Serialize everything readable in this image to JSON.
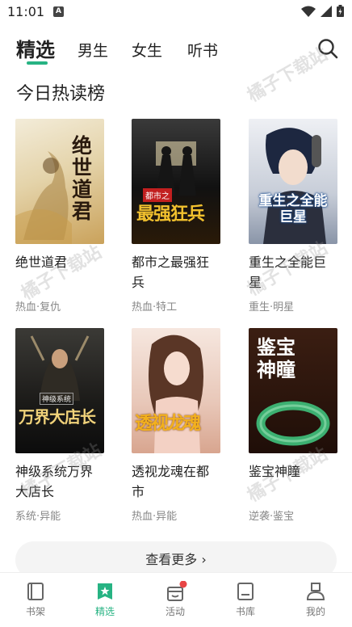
{
  "status": {
    "time": "11:01",
    "notif": "A"
  },
  "tabs": {
    "featured": "精选",
    "male": "男生",
    "female": "女生",
    "audio": "听书"
  },
  "section_title": "今日热读榜",
  "books": [
    {
      "title": "绝世道君",
      "tags": "热血·复仇",
      "cover_text": "绝世道君"
    },
    {
      "title": "都市之最强狂兵",
      "tags": "热血·特工",
      "cover_text": "最强狂兵"
    },
    {
      "title": "重生之全能巨星",
      "tags": "重生·明星",
      "cover_text": "重生之全能巨星"
    },
    {
      "title": "神级系统万界大店长",
      "tags": "系统·异能",
      "cover_text": "万界大店长"
    },
    {
      "title": "透视龙魂在都市",
      "tags": "热血·异能",
      "cover_text": "透视龙魂"
    },
    {
      "title": "鉴宝神瞳",
      "tags": "逆袭·鉴宝",
      "cover_text": "鉴宝神瞳"
    }
  ],
  "more_label": "查看更多",
  "watermark": "橘子下载站",
  "nav": {
    "shelf": "书架",
    "featured": "精选",
    "events": "活动",
    "library": "书库",
    "mine": "我的"
  },
  "colors": {
    "accent": "#27b383",
    "badge": "#e84545"
  }
}
